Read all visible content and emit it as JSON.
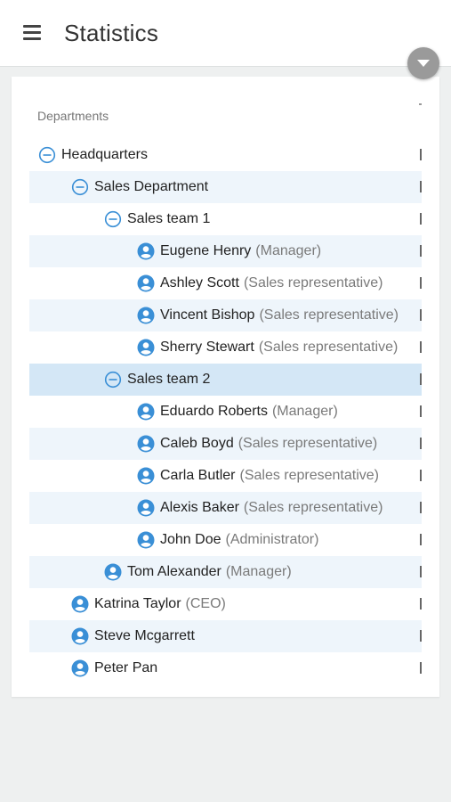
{
  "header": {
    "title": "Statistics"
  },
  "table": {
    "column_header": "Departments",
    "rows": [
      {
        "name": "Headquarters",
        "role": "",
        "type": "group",
        "level": 0,
        "shade": false,
        "selected": false
      },
      {
        "name": "Sales Department",
        "role": "",
        "type": "group",
        "level": 1,
        "shade": true,
        "selected": false
      },
      {
        "name": "Sales team 1",
        "role": "",
        "type": "group",
        "level": 2,
        "shade": false,
        "selected": false
      },
      {
        "name": "Eugene Henry",
        "role": "(Manager)",
        "type": "person",
        "level": 3,
        "shade": true,
        "selected": false
      },
      {
        "name": "Ashley Scott",
        "role": "(Sales representative)",
        "type": "person",
        "level": 3,
        "shade": false,
        "selected": false
      },
      {
        "name": "Vincent Bishop",
        "role": "(Sales representative)",
        "type": "person",
        "level": 3,
        "shade": true,
        "selected": false
      },
      {
        "name": "Sherry Stewart",
        "role": "(Sales representative)",
        "type": "person",
        "level": 3,
        "shade": false,
        "selected": false
      },
      {
        "name": "Sales team 2",
        "role": "",
        "type": "group",
        "level": 2,
        "shade": false,
        "selected": true
      },
      {
        "name": "Eduardo Roberts",
        "role": "(Manager)",
        "type": "person",
        "level": 3,
        "shade": false,
        "selected": false
      },
      {
        "name": "Caleb Boyd",
        "role": "(Sales representative)",
        "type": "person",
        "level": 3,
        "shade": true,
        "selected": false
      },
      {
        "name": "Carla Butler",
        "role": "(Sales representative)",
        "type": "person",
        "level": 3,
        "shade": false,
        "selected": false
      },
      {
        "name": "Alexis Baker",
        "role": "(Sales representative)",
        "type": "person",
        "level": 3,
        "shade": true,
        "selected": false
      },
      {
        "name": "John Doe",
        "role": "(Administrator)",
        "type": "person",
        "level": 3,
        "shade": false,
        "selected": false
      },
      {
        "name": "Tom Alexander",
        "role": "(Manager)",
        "type": "person",
        "level": 2,
        "shade": true,
        "selected": false
      },
      {
        "name": "Katrina Taylor",
        "role": "(CEO)",
        "type": "person",
        "level": 1,
        "shade": false,
        "selected": false
      },
      {
        "name": "Steve Mcgarrett",
        "role": "",
        "type": "person",
        "level": 1,
        "shade": true,
        "selected": false
      },
      {
        "name": "Peter Pan",
        "role": "",
        "type": "person",
        "level": 1,
        "shade": false,
        "selected": false
      }
    ]
  },
  "colors": {
    "accent": "#3a8fd6",
    "row_shade": "#eef5fb",
    "row_selected": "#d4e7f6"
  },
  "icons": {
    "menu": "hamburger-menu-icon",
    "fab": "chevron-down-icon",
    "group": "collapse-minus-icon",
    "person": "user-avatar-icon"
  }
}
